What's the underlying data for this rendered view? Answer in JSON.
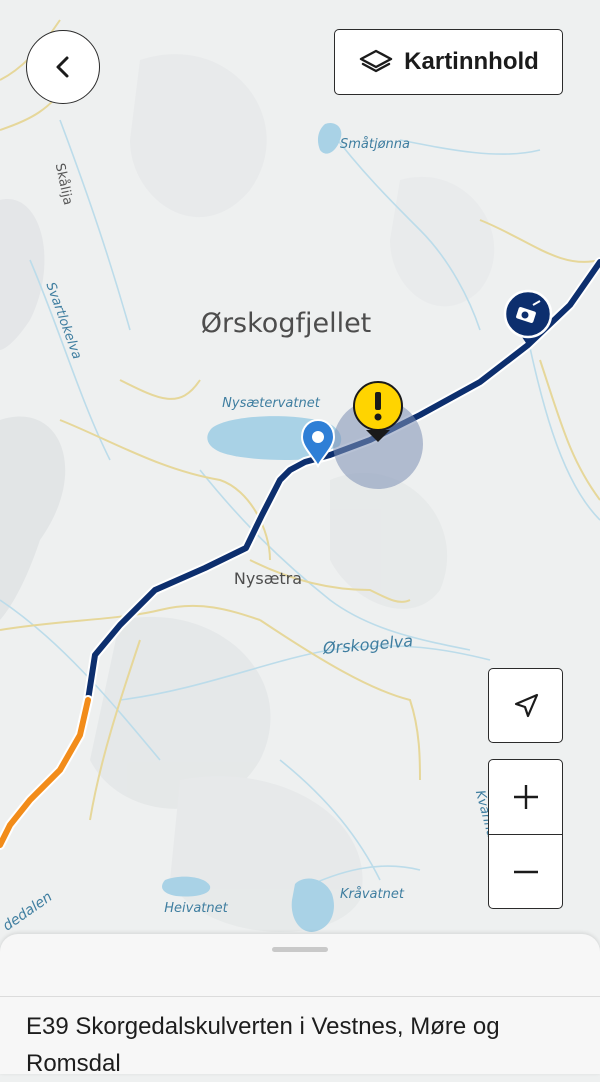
{
  "map": {
    "labels": {
      "mountain": "Ørskogfjellet",
      "village": "Nysætra",
      "lake_smatjonna": "Småtjønna",
      "lake_nysaetervatnet": "Nysætervatnet",
      "river_orskogelva": "Ørskogelva",
      "lake_kravatnet": "Kråvatnet",
      "lake_heivatnet": "Heivatnet",
      "river_svartlokelva": "Svartlokelva",
      "place_skalija": "Skålija",
      "place_kvanna": "Kvanna",
      "place_dalen": "dedalen"
    },
    "colors": {
      "road_primary": "#0d2f6e",
      "road_secondary": "#f28c1a",
      "water": "#a9d2e6",
      "terrain": "#eef0f0",
      "warning": "#ffd400",
      "location_pin": "#2f7fd6"
    },
    "markers": {
      "warning_icon": "exclamation-warning",
      "location_icon": "location-pin",
      "camera_icon": "traffic-camera"
    }
  },
  "controls": {
    "back_icon": "chevron-left",
    "layers_icon": "layers",
    "layers_label": "Kartinnhold",
    "locate_icon": "navigation-arrow",
    "zoom_in_icon": "plus",
    "zoom_out_icon": "minus"
  },
  "sheet": {
    "title": "E39 Skorgedalskulverten i Vestnes, Møre og Romsdal"
  }
}
